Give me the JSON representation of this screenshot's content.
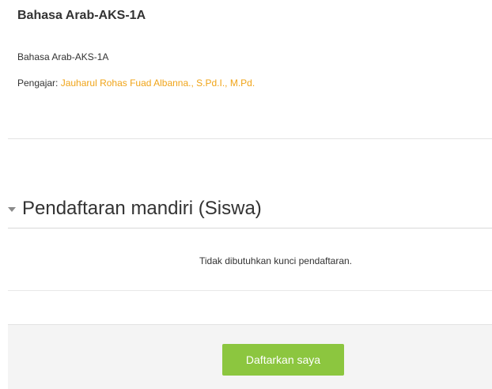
{
  "course": {
    "title": "Bahasa Arab-AKS-1A",
    "summary": "Bahasa Arab-AKS-1A",
    "teacher_label": "Pengajar: ",
    "teacher_name": "Jauharul Rohas Fuad Albanna., S.Pd.I., M.Pd."
  },
  "enrolment": {
    "section_title": "Pendaftaran mandiri (Siswa)",
    "info_text": "Tidak dibutuhkan kunci pendaftaran.",
    "enrol_button_label": "Daftarkan saya"
  },
  "colors": {
    "link": "#f0a418",
    "button": "#8cc63f",
    "action_bar": "#f4f4f4"
  },
  "icons": {
    "section_toggle": "collapse-triangle-icon"
  }
}
